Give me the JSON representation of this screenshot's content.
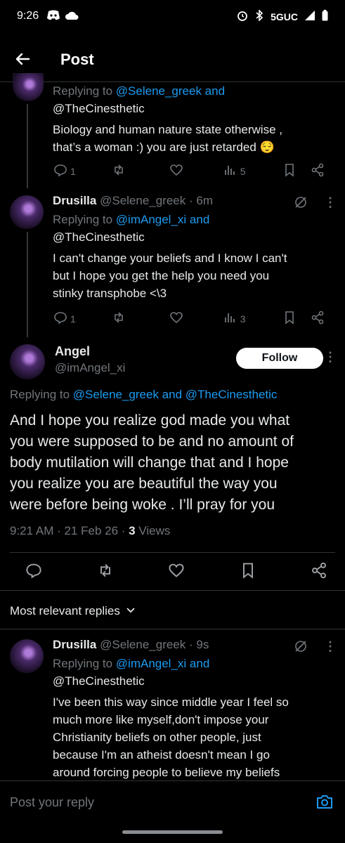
{
  "status_bar": {
    "time": "9:26",
    "network": "5GUC"
  },
  "header": {
    "title": "Post"
  },
  "tweet1": {
    "replying_prefix": "Replying to ",
    "replying_to_1": "@Selene_greek and",
    "replying_to_2": "@TheCinesthetic",
    "text_line1": "Biology and human nature state otherwise ,",
    "text_line2": "that’s a woman :) you are just retarded 😌",
    "replies": "1",
    "views": "5"
  },
  "tweet2": {
    "name": "Drusilla",
    "handle_time": "@Selene_greek · 6m",
    "replying_prefix": "Replying to ",
    "replying_to_1": "@imAngel_xi and",
    "replying_to_2": "@TheCinesthetic",
    "text_line1": "I can't change your beliefs and I know I can't",
    "text_line2": "but I hope you get the help you need you",
    "text_line3": "stinky transphobe <\\3",
    "replies": "1",
    "views": "3"
  },
  "main_tweet": {
    "name": "Angel",
    "handle": "@imAngel_xi",
    "follow_label": "Follow",
    "replying_prefix": "Replying to ",
    "replying_to": "@Selene_greek and @TheCinesthetic",
    "text_line1": "And I hope you realize god made you what",
    "text_line2": "you were supposed to be and no amount of",
    "text_line3": "body mutilation will change that and I hope",
    "text_line4": "you realize you are beautiful the way you",
    "text_line5": "were before being woke . I’ll pray for you",
    "timestamp": "9:21 AM · 21 Feb 26 · ",
    "views_count": "3",
    "views_label": " Views"
  },
  "replies_section": {
    "label": "Most relevant replies"
  },
  "reply1": {
    "name": "Drusilla",
    "handle_time": "@Selene_greek · 9s",
    "replying_prefix": "Replying to ",
    "replying_to_1": "@imAngel_xi and",
    "replying_to_2": "@TheCinesthetic",
    "text_line1": "I've been this way since middle year I feel so",
    "text_line2": "much more like myself,don't impose your",
    "text_line3": "Christianity beliefs on other people, just",
    "text_line4": "because I'm an atheist doesn't mean I go",
    "text_line5": "around forcing people to believe my beliefs"
  },
  "reply_bar": {
    "placeholder": "Post your reply"
  }
}
